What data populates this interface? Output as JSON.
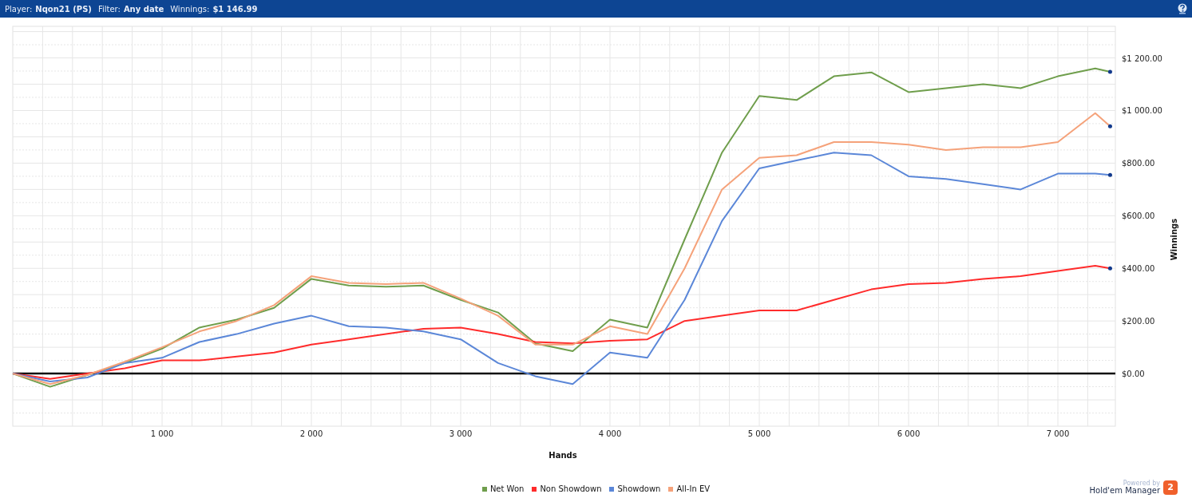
{
  "header": {
    "fields": [
      {
        "label": "Player:",
        "value": "Nqon21 (PS)"
      },
      {
        "label": "Filter:",
        "value": "Any date"
      },
      {
        "label": "Winnings:",
        "value": "$1 146.99"
      }
    ]
  },
  "chart": {
    "chart_data": {
      "type": "line",
      "grid": true,
      "xlabel": "Hands",
      "ylabel": "Winnings",
      "xlim": [
        0,
        7385
      ],
      "ylim": [
        -200,
        1320
      ],
      "xticks": [
        {
          "value": 1000,
          "label": "1 000"
        },
        {
          "value": 2000,
          "label": "2 000"
        },
        {
          "value": 3000,
          "label": "3 000"
        },
        {
          "value": 4000,
          "label": "4 000"
        },
        {
          "value": 5000,
          "label": "5 000"
        },
        {
          "value": 6000,
          "label": "6 000"
        },
        {
          "value": 7000,
          "label": "7 000"
        }
      ],
      "yticks": [
        {
          "value": 0,
          "label": "$0.00"
        },
        {
          "value": 200,
          "label": "$200.00"
        },
        {
          "value": 400,
          "label": "$400.00"
        },
        {
          "value": 600,
          "label": "$600.00"
        },
        {
          "value": 800,
          "label": "$800.00"
        },
        {
          "value": 1000,
          "label": "$1 000.00"
        },
        {
          "value": 1200,
          "label": "$1 200.00"
        }
      ],
      "x": [
        0,
        250,
        500,
        750,
        1000,
        1250,
        1500,
        1750,
        2000,
        2250,
        2500,
        2750,
        3000,
        3250,
        3500,
        3750,
        4000,
        4250,
        4500,
        4750,
        5000,
        5250,
        5500,
        5750,
        6000,
        6250,
        6500,
        6750,
        7000,
        7250,
        7350
      ],
      "series": [
        {
          "name": "Net Won",
          "color": "#6f9e4c",
          "values": [
            0,
            -50,
            -5,
            40,
            95,
            175,
            205,
            250,
            360,
            335,
            330,
            335,
            280,
            232,
            115,
            85,
            205,
            175,
            510,
            840,
            1055,
            1040,
            1130,
            1145,
            1070,
            1085,
            1100,
            1085,
            1130,
            1160,
            1147
          ]
        },
        {
          "name": "Non Showdown",
          "color": "#ff2b2b",
          "values": [
            0,
            -20,
            0,
            20,
            50,
            50,
            65,
            80,
            110,
            130,
            150,
            170,
            175,
            150,
            120,
            115,
            125,
            130,
            200,
            220,
            240,
            240,
            280,
            320,
            340,
            345,
            360,
            370,
            390,
            410,
            400
          ]
        },
        {
          "name": "Showdown",
          "color": "#5b87d8",
          "values": [
            0,
            -30,
            -15,
            40,
            60,
            120,
            150,
            190,
            220,
            180,
            175,
            160,
            130,
            40,
            -10,
            -40,
            80,
            60,
            280,
            580,
            780,
            810,
            840,
            830,
            750,
            740,
            720,
            700,
            760,
            760,
            755
          ]
        },
        {
          "name": "All-In EV",
          "color": "#f5a27a",
          "values": [
            0,
            -40,
            -5,
            45,
            100,
            160,
            200,
            260,
            370,
            345,
            340,
            345,
            285,
            220,
            110,
            110,
            180,
            150,
            400,
            700,
            820,
            830,
            880,
            880,
            870,
            850,
            860,
            860,
            880,
            990,
            940
          ]
        }
      ]
    }
  },
  "brand": {
    "tagline": "Powered by",
    "name": "Hold'em Manager",
    "badge": "2"
  }
}
